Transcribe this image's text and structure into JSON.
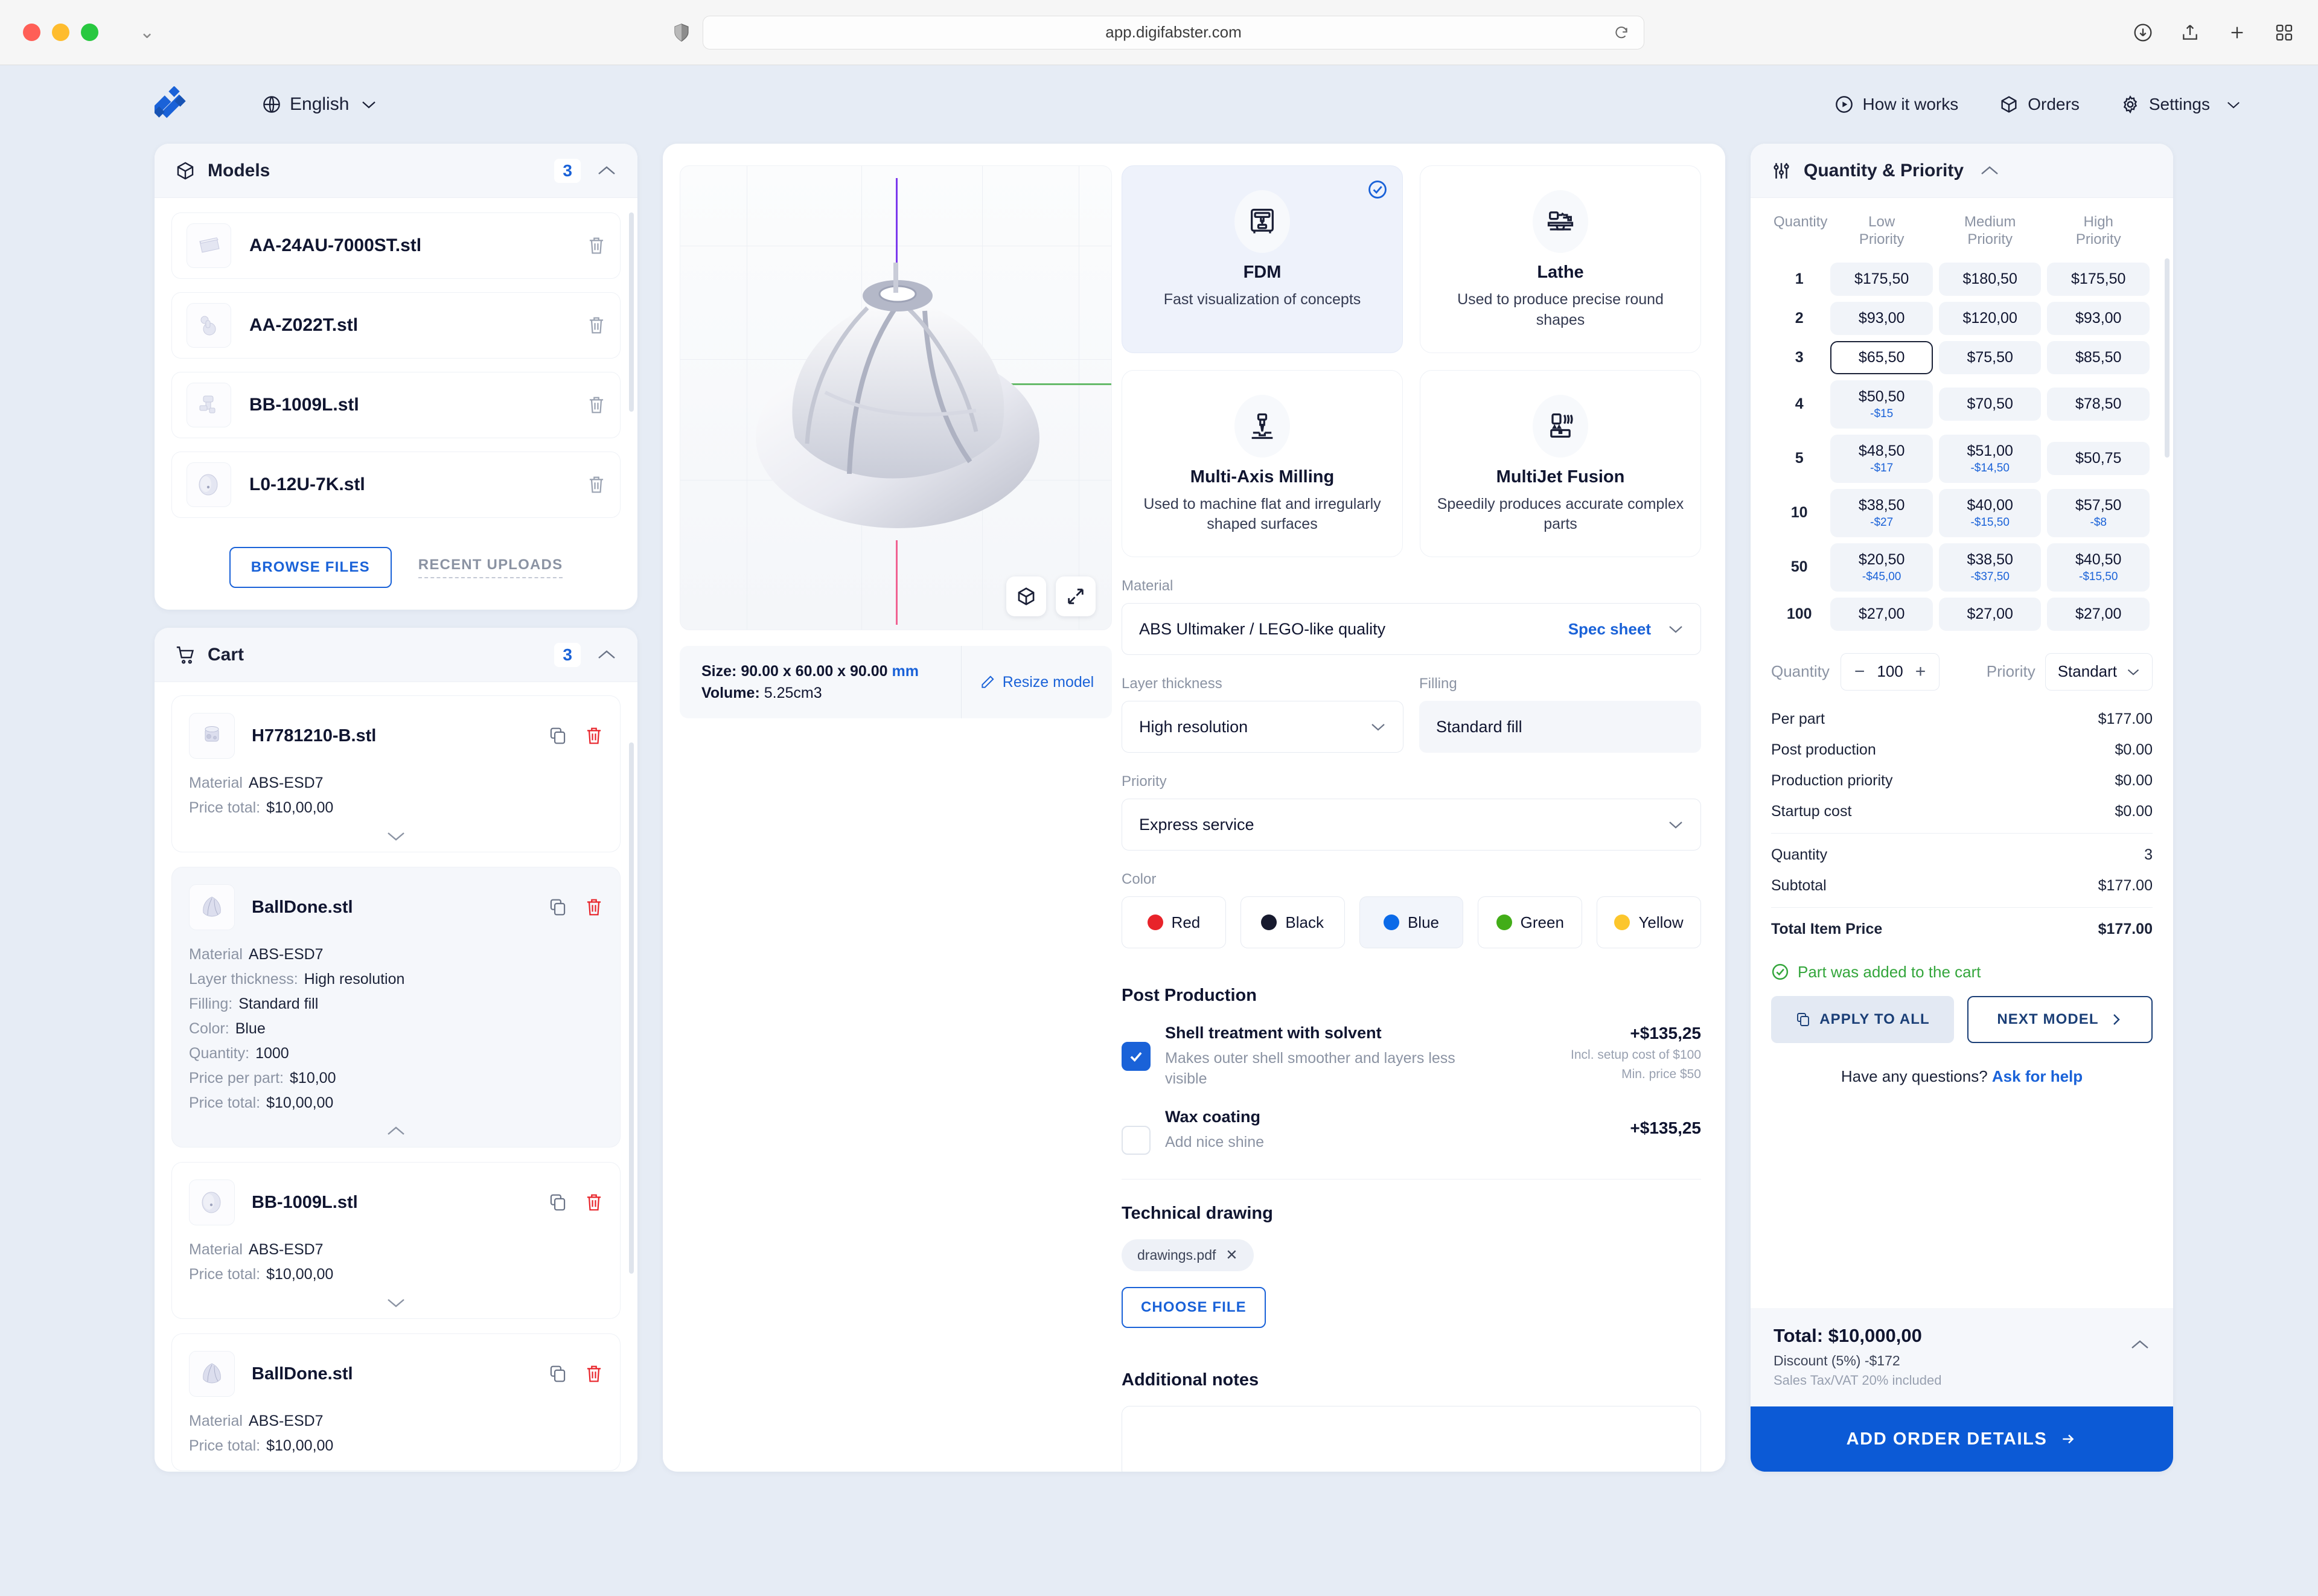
{
  "browser": {
    "url": "app.digifabster.com",
    "icons": [
      "shield-icon",
      "reload-icon",
      "download-icon",
      "share-icon",
      "new-tab-icon",
      "tab-overview-icon"
    ]
  },
  "header": {
    "logo_alt": "digifabster-logo",
    "language": "English",
    "nav": [
      {
        "label": "How it works",
        "icon": "play-circle-icon"
      },
      {
        "label": "Orders",
        "icon": "cube-icon"
      },
      {
        "label": "Settings",
        "icon": "gear-icon"
      }
    ]
  },
  "models_panel": {
    "title": "Models",
    "icon": "cube-icon",
    "count": "3",
    "items": [
      {
        "name": "AA-24AU-7000ST.stl"
      },
      {
        "name": "AA-Z022T.stl"
      },
      {
        "name": "BB-1009L.stl"
      },
      {
        "name": "L0-12U-7K.stl"
      }
    ],
    "browse_label": "BROWSE FILES",
    "recent_label": "RECENT UPLOADS"
  },
  "cart_panel": {
    "title": "Cart",
    "icon": "cart-icon",
    "count": "3",
    "items": [
      {
        "name": "H7781210-B.stl",
        "expanded": false,
        "specs": [
          {
            "label": "Material",
            "value": "ABS-ESD7"
          },
          {
            "label": "Price total:",
            "value": "$10,00,00"
          }
        ]
      },
      {
        "name": "BallDone.stl",
        "expanded": true,
        "specs": [
          {
            "label": "Material",
            "value": "ABS-ESD7"
          },
          {
            "label": "Layer thickness:",
            "value": "High resolution"
          },
          {
            "label": "Filling:",
            "value": "Standard fill"
          },
          {
            "label": "Color:",
            "value": "Blue"
          },
          {
            "label": "Quantity:",
            "value": "1000"
          },
          {
            "label": "Price per part:",
            "value": "$10,00"
          },
          {
            "label": "Price total:",
            "value": "$10,00,00"
          }
        ]
      },
      {
        "name": "BB-1009L.stl",
        "expanded": false,
        "specs": [
          {
            "label": "Material",
            "value": "ABS-ESD7"
          },
          {
            "label": "Price total:",
            "value": "$10,00,00"
          }
        ]
      },
      {
        "name": "BallDone.stl",
        "expanded": false,
        "specs": [
          {
            "label": "Material",
            "value": "ABS-ESD7"
          },
          {
            "label": "Price total:",
            "value": "$10,00,00"
          }
        ]
      }
    ]
  },
  "viewer": {
    "size_label": "Size:",
    "size_value": "90.00 x 60.00 x 90.00",
    "size_unit": "mm",
    "volume_label": "Volume:",
    "volume_value": "5.25cm3",
    "resize_label": "Resize model",
    "buttons": [
      "cube-view-icon",
      "fullscreen-icon"
    ]
  },
  "technologies": [
    {
      "name": "FDM",
      "desc": "Fast visualization of concepts",
      "icon": "fdm-printer-icon",
      "selected": true
    },
    {
      "name": "Lathe",
      "desc": "Used to produce precise round shapes",
      "icon": "lathe-icon",
      "selected": false
    },
    {
      "name": "Multi-Axis Milling",
      "desc": "Used to machine flat and irregularly shaped surfaces",
      "icon": "milling-icon",
      "selected": false
    },
    {
      "name": "MultiJet Fusion",
      "desc": "Speedily produces accurate complex parts",
      "icon": "multijet-icon",
      "selected": false
    }
  ],
  "config": {
    "material_label": "Material",
    "material_value": "ABS Ultimaker / LEGO-like quality",
    "spec_sheet_label": "Spec sheet",
    "layer_label": "Layer thickness",
    "layer_value": "High resolution",
    "filling_label": "Filling",
    "filling_value": "Standard fill",
    "priority_label": "Priority",
    "priority_value": "Express service",
    "color_label": "Color",
    "colors": [
      {
        "name": "Red",
        "hex": "#e8232a",
        "selected": false
      },
      {
        "name": "Black",
        "hex": "#171a2e",
        "selected": false
      },
      {
        "name": "Blue",
        "hex": "#0b6ae8",
        "selected": true
      },
      {
        "name": "Green",
        "hex": "#42ad18",
        "selected": false
      },
      {
        "name": "Yellow",
        "hex": "#fcc62c",
        "selected": false
      }
    ]
  },
  "post_production": {
    "title": "Post Production",
    "options": [
      {
        "name": "Shell treatment with solvent",
        "desc": "Makes outer shell smoother and layers less visible",
        "price": "+$135,25",
        "note1": "Incl. setup cost of $100",
        "note2": "Min. price $50",
        "checked": true
      },
      {
        "name": "Wax coating",
        "desc": "Add nice shine",
        "price": "+$135,25",
        "note1": "",
        "note2": "",
        "checked": false
      }
    ]
  },
  "technical_drawing": {
    "title": "Technical drawing",
    "file_chip": "drawings.pdf",
    "choose_label": "CHOOSE FILE"
  },
  "additional_notes": {
    "title": "Additional notes",
    "value": ""
  },
  "quantity_priority": {
    "title": "Quantity & Priority",
    "icon": "sliders-icon",
    "columns": [
      "Quantity",
      "Low Priority",
      "Medium Priority",
      "High Priority"
    ],
    "rows": [
      {
        "qty": "1",
        "low": "$175,50",
        "low_disc": "",
        "med": "$180,50",
        "med_disc": "",
        "high": "$175,50",
        "high_disc": "",
        "selected": ""
      },
      {
        "qty": "2",
        "low": "$93,00",
        "low_disc": "",
        "med": "$120,00",
        "med_disc": "",
        "high": "$93,00",
        "high_disc": "",
        "selected": ""
      },
      {
        "qty": "3",
        "low": "$65,50",
        "low_disc": "",
        "med": "$75,50",
        "med_disc": "",
        "high": "$85,50",
        "high_disc": "",
        "selected": "low"
      },
      {
        "qty": "4",
        "low": "$50,50",
        "low_disc": "-$15",
        "med": "$70,50",
        "med_disc": "",
        "high": "$78,50",
        "high_disc": "",
        "selected": ""
      },
      {
        "qty": "5",
        "low": "$48,50",
        "low_disc": "-$17",
        "med": "$51,00",
        "med_disc": "-$14,50",
        "high": "$50,75",
        "high_disc": "",
        "selected": ""
      },
      {
        "qty": "10",
        "low": "$38,50",
        "low_disc": "-$27",
        "med": "$40,00",
        "med_disc": "-$15,50",
        "high": "$57,50",
        "high_disc": "-$8",
        "selected": ""
      },
      {
        "qty": "50",
        "low": "$20,50",
        "low_disc": "-$45,00",
        "med": "$38,50",
        "med_disc": "-$37,50",
        "high": "$40,50",
        "high_disc": "-$15,50",
        "selected": ""
      },
      {
        "qty": "100",
        "low": "$27,00",
        "low_disc": "",
        "med": "$27,00",
        "med_disc": "",
        "high": "$27,00",
        "high_disc": "",
        "selected": ""
      }
    ],
    "qty_label": "Quantity",
    "qty_value": "100",
    "priority_label": "Priority",
    "priority_value": "Standart"
  },
  "summary": {
    "lines": [
      {
        "label": "Per part",
        "value": "$177.00"
      },
      {
        "label": "Post production",
        "value": "$0.00"
      },
      {
        "label": "Production priority",
        "value": "$0.00"
      },
      {
        "label": "Startup cost",
        "value": "$0.00"
      }
    ],
    "lines2": [
      {
        "label": "Quantity",
        "value": "3"
      },
      {
        "label": "Subtotal",
        "value": "$177.00"
      }
    ],
    "total_label": "Total Item Price",
    "total_value": "$177.00",
    "added_message": "Part was added to the cart",
    "apply_label": "APPLY TO ALL",
    "next_label": "NEXT MODEL",
    "help_text": "Have any questions?",
    "help_link": "Ask for help"
  },
  "footer": {
    "total": "Total: $10,000,00",
    "discount": "Discount (5%) -$172",
    "tax": "Sales Tax/VAT 20% included",
    "order_button": "ADD ORDER DETAILS"
  },
  "colors": {
    "accent": "#1a62d8",
    "primary_button": "#0c5ad6",
    "success": "#34a63c",
    "danger": "#e8232a",
    "app_bg": "#e6ecf5"
  }
}
